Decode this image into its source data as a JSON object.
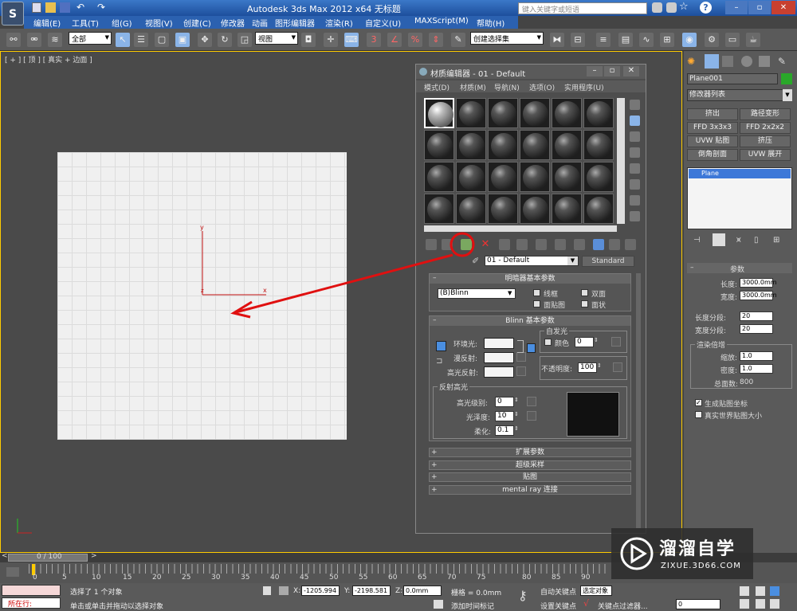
{
  "app": {
    "title": "Autodesk 3ds Max  2012 x64      无标题",
    "search_placeholder": "键入关键字或短语"
  },
  "menu": [
    "编辑(E)",
    "工具(T)",
    "组(G)",
    "视图(V)",
    "创建(C)",
    "修改器",
    "动画",
    "图形编辑器",
    "渲染(R)",
    "自定义(U)",
    "MAXScript(M)",
    "帮助(H)"
  ],
  "toolbar": {
    "selection_filter": "全部",
    "coord_system": "视图",
    "named_selection": "创建选择集"
  },
  "viewport": {
    "label": "[ + ] [ 顶 ] [ 真实 + 边面 ]",
    "axis_x": "x",
    "axis_y": "y",
    "axis_z": "z"
  },
  "material_editor": {
    "title": "材质编辑器 - 01 - Default",
    "menus": [
      "模式(D)",
      "材质(M)",
      "导航(N)",
      "选项(O)",
      "实用程序(U)"
    ],
    "material_name": "01 - Default",
    "material_type": "Standard",
    "shader_rollout": {
      "title": "明暗器基本参数",
      "shader": "(B)Blinn",
      "options": [
        "线框",
        "双面",
        "面贴图",
        "面状"
      ]
    },
    "blinn_rollout": {
      "title": "Blinn 基本参数",
      "self_illum_group": "自发光",
      "color_label": "颜色",
      "color_value": "0",
      "ambient": "环境光:",
      "diffuse": "漫反射:",
      "specular": "高光反射:",
      "opacity_label": "不透明度:",
      "opacity_value": "100",
      "highlight_group": "反射高光",
      "spec_level_label": "高光级别:",
      "spec_level": "0",
      "glossiness_label": "光泽度:",
      "glossiness": "10",
      "soften_label": "柔化:",
      "soften": "0.1"
    },
    "collapsed_rollouts": [
      "扩展参数",
      "超级采样",
      "贴图",
      "mental ray 连接"
    ]
  },
  "command_panel": {
    "object_name": "Plane001",
    "modifier_list": "修改器列表",
    "modifier_buttons": [
      "挤出",
      "路径变形",
      "FFD 3x3x3",
      "FFD 2x2x2",
      "UVW 贴图",
      "挤压",
      "倒角剖面",
      "UVW 展开"
    ],
    "stack_item": "Plane",
    "params_title": "参数",
    "length_label": "长度:",
    "length": "3000.0mm",
    "width_label": "宽度:",
    "width": "3000.0mm",
    "length_segs_label": "长度分段:",
    "length_segs": "20",
    "width_segs_label": "宽度分段:",
    "width_segs": "20",
    "render_mult_title": "渲染倍增",
    "scale_label": "缩放:",
    "scale": "1.0",
    "density_label": "密度:",
    "density": "1.0",
    "total_faces_label": "总面数:",
    "total_faces": "800",
    "gen_mapping": "生成贴图坐标",
    "real_world": "真实世界贴图大小"
  },
  "timeline": {
    "frame": "0 / 100",
    "ticks": [
      "0",
      "5",
      "10",
      "15",
      "20",
      "25",
      "30",
      "35",
      "40",
      "45",
      "50",
      "55",
      "60",
      "65",
      "70",
      "75",
      "80",
      "85",
      "90"
    ]
  },
  "status": {
    "script_label": "所在行:",
    "selected": "选择了 1 个对象",
    "prompt": "单击或单击并拖动以选择对象",
    "x_label": "X:",
    "x": "-1205.994",
    "y_label": "Y:",
    "y": "-2198.581",
    "z_label": "Z:",
    "z": "0.0mm",
    "grid": "栅格 = 0.0mm",
    "add_time_tag": "添加时间标记",
    "auto_key": "自动关键点",
    "set_key": "设置关键点",
    "selected_obj": "选定对象",
    "key_filters": "关键点过滤器...",
    "frame_field": "0"
  },
  "watermark": {
    "brand": "溜溜自学",
    "url": "ZIXUE.3D66.COM"
  },
  "colors": {
    "highlight_red": "#e01010",
    "title_blue": "#2b61b0",
    "stack_blue": "#3d78d8"
  }
}
